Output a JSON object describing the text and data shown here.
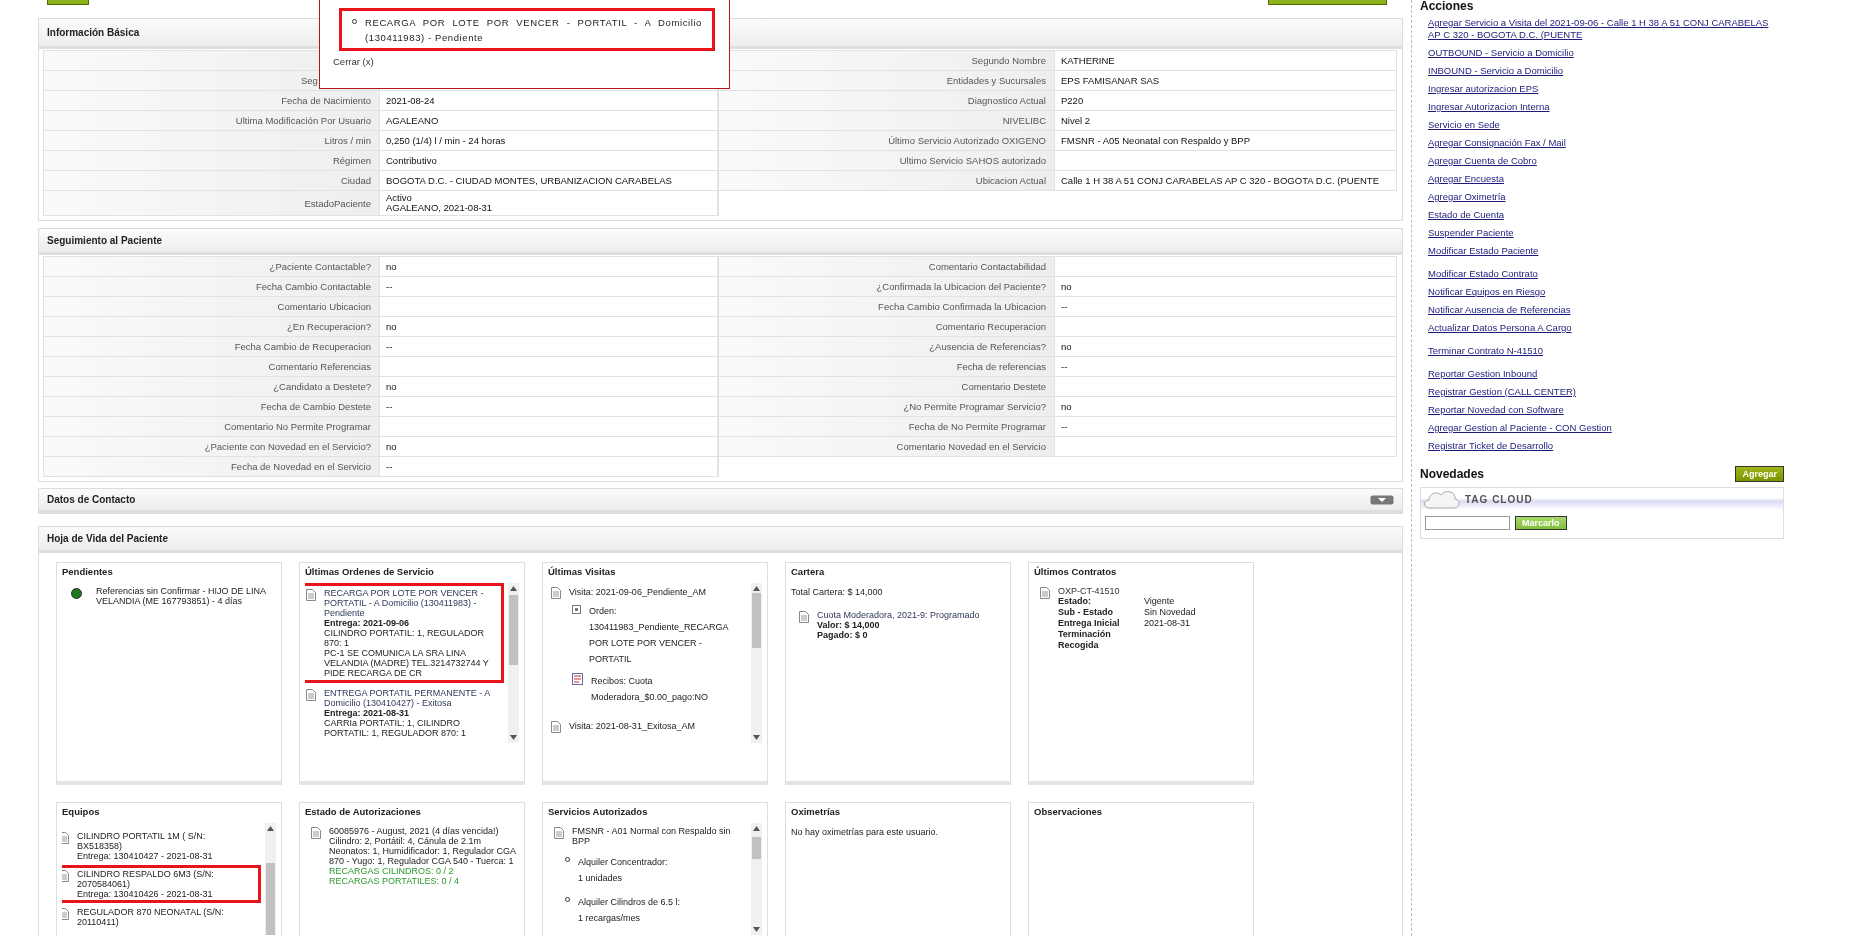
{
  "popup": {
    "items": [
      {
        "text": "RECARGA POR LOTE POR VENCER - PORTATIL - A Domicilio (130411983) - Pendiente",
        "highlighted": true
      }
    ],
    "close": "Cerrar (x)"
  },
  "basic_info": {
    "title": "Información Básica",
    "left_rows": [
      {
        "kind": "hidden"
      },
      {
        "kind": "covered",
        "label": "Seg"
      },
      {
        "kind": "row",
        "label": "Fecha de Nacimiento",
        "value": "2021-08-24"
      },
      {
        "kind": "row",
        "label": "Ultima Modificación Por Usuario",
        "value": "AGALEANO"
      },
      {
        "kind": "row",
        "label": "Litros / min",
        "value": "0,250 (1/4) l / min - 24 horas"
      },
      {
        "kind": "row",
        "label": "Régimen",
        "value": "Contributivo"
      },
      {
        "kind": "row",
        "label": "Ciudad",
        "value": "BOGOTA D.C. - CIUDAD MONTES, URBANIZACION CARABELAS"
      },
      {
        "kind": "row",
        "label": "EstadoPaciente",
        "value": "Activo\nAGALEANO, 2021-08-31"
      }
    ],
    "right_rows": [
      {
        "kind": "row",
        "label": "Segundo Nombre",
        "value": "KATHERINE"
      },
      {
        "kind": "row",
        "label": "Entidades y Sucursales",
        "value": "EPS FAMISANAR SAS"
      },
      {
        "kind": "row",
        "label": "Diagnostico Actual",
        "value": "P220"
      },
      {
        "kind": "row",
        "label": "NIVELIBC",
        "value": "Nivel 2"
      },
      {
        "kind": "row",
        "label": "Último Servicio Autorizado OXIGENO",
        "value": "FMSNR - A05 Neonatal con Respaldo y BPP"
      },
      {
        "kind": "row",
        "label": "Ultimo Servicio SAHOS autorizado"
      },
      {
        "kind": "row",
        "label": "Ubicacion Actual",
        "value": "Calle 1 H 38 A 51 CONJ CARABELAS AP C 320 - BOGOTA D.C. (PUENTE"
      }
    ]
  },
  "follow_up": {
    "title": "Seguimiento al Paciente",
    "left_rows": [
      {
        "kind": "row",
        "label": "¿Paciente Contactable?",
        "value": "no"
      },
      {
        "kind": "row",
        "label": "Fecha Cambio Contactable",
        "value": "--"
      },
      {
        "kind": "row",
        "label": "Comentario Ubicacion"
      },
      {
        "kind": "row",
        "label": "¿En Recuperacion?",
        "value": "no"
      },
      {
        "kind": "row",
        "label": "Fecha Cambio de Recuperacion",
        "value": "--"
      },
      {
        "kind": "row",
        "label": "Comentario Referencias"
      },
      {
        "kind": "row",
        "label": "¿Candidato a Destete?",
        "value": "no"
      },
      {
        "kind": "row",
        "label": "Fecha de Cambio Destete",
        "value": "--"
      },
      {
        "kind": "row",
        "label": "Comentario No Permite Programar"
      },
      {
        "kind": "row",
        "label": "¿Paciente con Novedad en el Servicio?",
        "value": "no"
      },
      {
        "kind": "row",
        "label": "Fecha de Novedad en el Servicio",
        "value": "--"
      }
    ],
    "right_rows": [
      {
        "kind": "row",
        "label": "Comentario Contactabilidad"
      },
      {
        "kind": "row",
        "label": "¿Confirmada la Ubicacion del Paciente?",
        "value": "no"
      },
      {
        "kind": "row",
        "label": "Fecha Cambio Confirmada la Ubicacion",
        "value": "--"
      },
      {
        "kind": "row",
        "label": "Comentario Recuperacion"
      },
      {
        "kind": "row",
        "label": "¿Ausencia de Referencias?",
        "value": "no"
      },
      {
        "kind": "row",
        "label": "Fecha de referencias",
        "value": "--"
      },
      {
        "kind": "row",
        "label": "Comentario Destete"
      },
      {
        "kind": "row",
        "label": "¿No Permite Programar Servicio?",
        "value": "no"
      },
      {
        "kind": "row",
        "label": "Fecha de No Permite Programar",
        "value": "--"
      },
      {
        "kind": "row",
        "label": "Comentario Novedad en el Servicio"
      }
    ]
  },
  "contact": {
    "title": "Datos de Contacto",
    "expanded": false
  },
  "history": {
    "title": "Hoja de Vida del Paciente",
    "cards": [
      {
        "kind": "pending",
        "title": "Pendientes",
        "items": [
          {
            "text": "Referencias sin Confirmar - HIJO DE LINA VELANDIA (ME 167793851) - 4 días",
            "color": "#1f7a1f"
          }
        ]
      },
      {
        "kind": "orders",
        "title": "Últimas Ordenes de Servicio",
        "items": [
          {
            "title": "RECARGA POR LOTE POR VENCER - PORTATIL - A Domicilio (130411983) - Pendiente",
            "delivery": "Entrega: 2021-09-06",
            "details": "CILINDRO PORTATIL: 1, REGULADOR 870: 1",
            "note": "PC-1 SE COMUNICA LA SRA LINA VELANDIA (MADRE) TEL.3214732744 Y PIDE RECARGA DE CR",
            "highlighted": true
          },
          {
            "title": "ENTREGA PORTATIL PERMANENTE - A Domicilio (130410427) - Exitosa",
            "delivery": "Entrega: 2021-08-31",
            "details": "CARRIa PORTATIL: 1, CILINDRO PORTATIL: 1, REGULADOR 870: 1",
            "highlighted": false
          }
        ]
      },
      {
        "kind": "visits",
        "title": "Últimas Visitas",
        "items": [
          {
            "visit": "Visita: 2021-09-06_Pendiente_AM",
            "order_label": "Orden:",
            "order": "130411983_Pendiente_RECARGA POR LOTE POR VENCER - PORTATIL",
            "receipt": "Recibos: Cuota Moderadora_$0.00_pago:NO"
          },
          {
            "visit": "Visita: 2021-08-31_Exitosa_AM"
          }
        ]
      },
      {
        "kind": "wallet",
        "title": "Cartera",
        "total": "Total Cartera: $ 14,000",
        "items": [
          {
            "concept": "Cuota Moderadora, 2021-9: Programado",
            "value": "Valor: $ 14,000",
            "paid": "Pagado: $ 0"
          }
        ]
      },
      {
        "kind": "contracts",
        "title": "Últimos Contratos",
        "items": [
          {
            "code": "OXP-CT-41510",
            "fields": [
              {
                "label": "Estado:",
                "value": "Vigente"
              },
              {
                "label": "Sub - Estado",
                "value": "Sin Novedad"
              },
              {
                "label": "Entrega Inicial",
                "value": "2021-08-31"
              },
              {
                "label": "Terminación"
              },
              {
                "label": "Recogida"
              }
            ]
          }
        ]
      },
      {
        "kind": "equipment",
        "title": "Equipos",
        "items": [
          {
            "name": "CILINDRO PORTATIL 1M ( S/N: BX518358)",
            "delivery": "Entrega: 130410427 - 2021-08-31",
            "highlighted": false
          },
          {
            "name": "CILINDRO RESPALDO 6M3 (S/N: 2070584061)",
            "delivery": "Entrega: 130410426 - 2021-08-31",
            "highlighted": true
          },
          {
            "name": "REGULADOR 870 NEONATAL (S/N: 20110411)",
            "highlighted": false
          }
        ]
      },
      {
        "kind": "authorizations",
        "title": "Estado de Autorizaciones",
        "items": [
          {
            "heading": "60085976 - August, 2021 (4 días vencida!)",
            "details": "Cilindro: 2, Portátil: 4, Cánula de 2.1m Neonatos: 1, Humidificador: 1, Regulador CGA 870 - Yugo: 1, Regulador CGA 540 - Tuerca: 1",
            "counters": [
              "RECARGAS CILINDROS: 0 / 2",
              "RECARGAS PORTATILES: 0 / 4"
            ]
          }
        ]
      },
      {
        "kind": "services",
        "title": "Servicios Autorizados",
        "plan": "FMSNR - A01 Normal con Respaldo sin BPP",
        "items": [
          {
            "name": "Alquiler Concentrador:",
            "amount": "1 unidades"
          },
          {
            "name": "Alquiler Cilindros de 6.5 l:",
            "amount": "1 recargas/mes"
          }
        ]
      },
      {
        "kind": "oximetry",
        "title": "Oximetrías",
        "message": "No hay oximetrías para este usuario."
      },
      {
        "kind": "notes",
        "title": "Observaciones"
      }
    ]
  },
  "sidebar": {
    "title": "Acciones",
    "groups": [
      [
        "Agregar Servicio a Visita del 2021-09-06 - Calle 1 H 38 A 51 CONJ CARABELAS AP C 320 - BOGOTA D.C. (PUENTE",
        "OUTBOUND - Servicio a Domicilio",
        "INBOUND - Servicio a Domicilio",
        "Ingresar autorizacion EPS",
        "Ingresar Autorizacion Interna",
        "Servicio en Sede",
        "Agregar Consignación Fax / Mail",
        "Agregar Cuenta de Cobro",
        "Agregar Encuesta",
        "Agregar Oximetría",
        "Estado de Cuenta",
        "Suspender Paciente",
        "Modificar Estado Paciente"
      ],
      [
        "Modificar Estado Contrato",
        "Notificar Equipos en Riesgo",
        "Notificar Ausencia de Referencias",
        "Actualizar Datos Persona A Cargo"
      ],
      [
        "Terminar Contrato N-41510"
      ],
      [
        "Reportar Gestion Inbound",
        "Registrar Gestion (CALL CENTER)",
        "Reportar Novedad con Software",
        "Agregar Gestion al Paciente - CON Gestion",
        "Registrar Ticket de Desarrollo"
      ]
    ],
    "news": {
      "title": "Novedades",
      "add": "Agregar",
      "tag_cloud": "TAG CLOUD",
      "mark": "Marcarlo"
    }
  }
}
